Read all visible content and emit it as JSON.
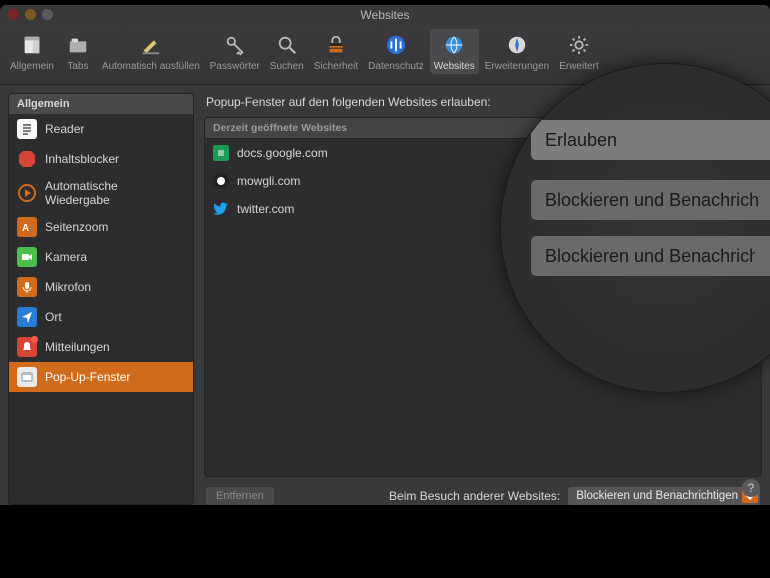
{
  "window_title": "Websites",
  "toolbar": [
    {
      "id": "general",
      "label": "Allgemein"
    },
    {
      "id": "tabs",
      "label": "Tabs"
    },
    {
      "id": "autofill",
      "label": "Automatisch ausfüllen"
    },
    {
      "id": "passwords",
      "label": "Passwörter"
    },
    {
      "id": "search",
      "label": "Suchen"
    },
    {
      "id": "security",
      "label": "Sicherheit"
    },
    {
      "id": "privacy",
      "label": "Datenschutz"
    },
    {
      "id": "websites",
      "label": "Websites"
    },
    {
      "id": "extensions",
      "label": "Erweiterungen"
    },
    {
      "id": "advanced",
      "label": "Erweitert"
    }
  ],
  "sidebar": {
    "header": "Allgemein",
    "items": [
      {
        "id": "reader",
        "label": "Reader"
      },
      {
        "id": "content-blockers",
        "label": "Inhaltsblocker"
      },
      {
        "id": "autoplay",
        "label": "Automatische Wiedergabe"
      },
      {
        "id": "page-zoom",
        "label": "Seitenzoom"
      },
      {
        "id": "camera",
        "label": "Kamera"
      },
      {
        "id": "microphone",
        "label": "Mikrofon"
      },
      {
        "id": "location",
        "label": "Ort"
      },
      {
        "id": "notifications",
        "label": "Mitteilungen"
      },
      {
        "id": "popups",
        "label": "Pop-Up-Fenster"
      }
    ],
    "selected": "popups"
  },
  "main": {
    "heading": "Popup-Fenster auf den folgenden Websites erlauben:",
    "group_header": "Derzeit geöffnete Websites",
    "sites": [
      {
        "icon": "google-docs",
        "domain": "docs.google.com"
      },
      {
        "icon": "mowgli",
        "domain": "mowgli.com"
      },
      {
        "icon": "twitter",
        "domain": "twitter.com"
      }
    ],
    "remove_label": "Entfernen",
    "default_label": "Beim Besuch anderer Websites:",
    "default_value": "Blockieren und Benachrichtigen"
  },
  "zoom_popup": {
    "options": [
      "Erlauben",
      "Blockieren und Benachrichtigen",
      "Blockieren und Benachrichtigen"
    ],
    "selected_index": 0
  },
  "colors": {
    "accent": "#cf6b1a",
    "bg": "#39393b",
    "panel": "#2d2d2f"
  }
}
